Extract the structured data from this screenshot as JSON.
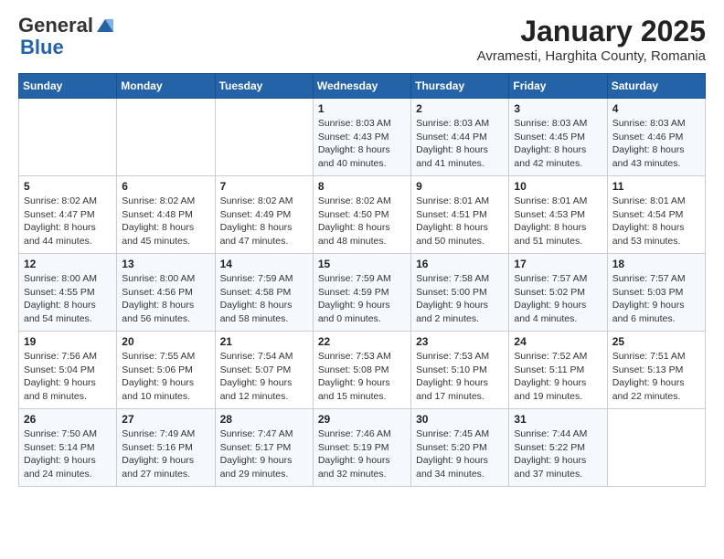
{
  "header": {
    "logo_general": "General",
    "logo_blue": "Blue",
    "month_title": "January 2025",
    "location": "Avramesti, Harghita County, Romania"
  },
  "days_of_week": [
    "Sunday",
    "Monday",
    "Tuesday",
    "Wednesday",
    "Thursday",
    "Friday",
    "Saturday"
  ],
  "weeks": [
    [
      {
        "day": "",
        "info": ""
      },
      {
        "day": "",
        "info": ""
      },
      {
        "day": "",
        "info": ""
      },
      {
        "day": "1",
        "info": "Sunrise: 8:03 AM\nSunset: 4:43 PM\nDaylight: 8 hours\nand 40 minutes."
      },
      {
        "day": "2",
        "info": "Sunrise: 8:03 AM\nSunset: 4:44 PM\nDaylight: 8 hours\nand 41 minutes."
      },
      {
        "day": "3",
        "info": "Sunrise: 8:03 AM\nSunset: 4:45 PM\nDaylight: 8 hours\nand 42 minutes."
      },
      {
        "day": "4",
        "info": "Sunrise: 8:03 AM\nSunset: 4:46 PM\nDaylight: 8 hours\nand 43 minutes."
      }
    ],
    [
      {
        "day": "5",
        "info": "Sunrise: 8:02 AM\nSunset: 4:47 PM\nDaylight: 8 hours\nand 44 minutes."
      },
      {
        "day": "6",
        "info": "Sunrise: 8:02 AM\nSunset: 4:48 PM\nDaylight: 8 hours\nand 45 minutes."
      },
      {
        "day": "7",
        "info": "Sunrise: 8:02 AM\nSunset: 4:49 PM\nDaylight: 8 hours\nand 47 minutes."
      },
      {
        "day": "8",
        "info": "Sunrise: 8:02 AM\nSunset: 4:50 PM\nDaylight: 8 hours\nand 48 minutes."
      },
      {
        "day": "9",
        "info": "Sunrise: 8:01 AM\nSunset: 4:51 PM\nDaylight: 8 hours\nand 50 minutes."
      },
      {
        "day": "10",
        "info": "Sunrise: 8:01 AM\nSunset: 4:53 PM\nDaylight: 8 hours\nand 51 minutes."
      },
      {
        "day": "11",
        "info": "Sunrise: 8:01 AM\nSunset: 4:54 PM\nDaylight: 8 hours\nand 53 minutes."
      }
    ],
    [
      {
        "day": "12",
        "info": "Sunrise: 8:00 AM\nSunset: 4:55 PM\nDaylight: 8 hours\nand 54 minutes."
      },
      {
        "day": "13",
        "info": "Sunrise: 8:00 AM\nSunset: 4:56 PM\nDaylight: 8 hours\nand 56 minutes."
      },
      {
        "day": "14",
        "info": "Sunrise: 7:59 AM\nSunset: 4:58 PM\nDaylight: 8 hours\nand 58 minutes."
      },
      {
        "day": "15",
        "info": "Sunrise: 7:59 AM\nSunset: 4:59 PM\nDaylight: 9 hours\nand 0 minutes."
      },
      {
        "day": "16",
        "info": "Sunrise: 7:58 AM\nSunset: 5:00 PM\nDaylight: 9 hours\nand 2 minutes."
      },
      {
        "day": "17",
        "info": "Sunrise: 7:57 AM\nSunset: 5:02 PM\nDaylight: 9 hours\nand 4 minutes."
      },
      {
        "day": "18",
        "info": "Sunrise: 7:57 AM\nSunset: 5:03 PM\nDaylight: 9 hours\nand 6 minutes."
      }
    ],
    [
      {
        "day": "19",
        "info": "Sunrise: 7:56 AM\nSunset: 5:04 PM\nDaylight: 9 hours\nand 8 minutes."
      },
      {
        "day": "20",
        "info": "Sunrise: 7:55 AM\nSunset: 5:06 PM\nDaylight: 9 hours\nand 10 minutes."
      },
      {
        "day": "21",
        "info": "Sunrise: 7:54 AM\nSunset: 5:07 PM\nDaylight: 9 hours\nand 12 minutes."
      },
      {
        "day": "22",
        "info": "Sunrise: 7:53 AM\nSunset: 5:08 PM\nDaylight: 9 hours\nand 15 minutes."
      },
      {
        "day": "23",
        "info": "Sunrise: 7:53 AM\nSunset: 5:10 PM\nDaylight: 9 hours\nand 17 minutes."
      },
      {
        "day": "24",
        "info": "Sunrise: 7:52 AM\nSunset: 5:11 PM\nDaylight: 9 hours\nand 19 minutes."
      },
      {
        "day": "25",
        "info": "Sunrise: 7:51 AM\nSunset: 5:13 PM\nDaylight: 9 hours\nand 22 minutes."
      }
    ],
    [
      {
        "day": "26",
        "info": "Sunrise: 7:50 AM\nSunset: 5:14 PM\nDaylight: 9 hours\nand 24 minutes."
      },
      {
        "day": "27",
        "info": "Sunrise: 7:49 AM\nSunset: 5:16 PM\nDaylight: 9 hours\nand 27 minutes."
      },
      {
        "day": "28",
        "info": "Sunrise: 7:47 AM\nSunset: 5:17 PM\nDaylight: 9 hours\nand 29 minutes."
      },
      {
        "day": "29",
        "info": "Sunrise: 7:46 AM\nSunset: 5:19 PM\nDaylight: 9 hours\nand 32 minutes."
      },
      {
        "day": "30",
        "info": "Sunrise: 7:45 AM\nSunset: 5:20 PM\nDaylight: 9 hours\nand 34 minutes."
      },
      {
        "day": "31",
        "info": "Sunrise: 7:44 AM\nSunset: 5:22 PM\nDaylight: 9 hours\nand 37 minutes."
      },
      {
        "day": "",
        "info": ""
      }
    ]
  ]
}
